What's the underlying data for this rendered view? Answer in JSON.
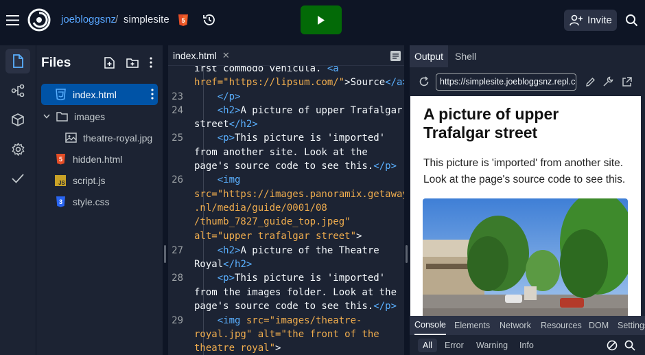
{
  "topbar": {
    "user": "joebloggsnz",
    "separator": "/",
    "repl_name": "simplesite",
    "invite_label": "Invite"
  },
  "sidebar_rail": {
    "items": [
      "files-icon",
      "git-icon",
      "packages-icon",
      "settings-icon",
      "check-icon"
    ]
  },
  "files": {
    "title": "Files",
    "items": [
      {
        "name": "index.html",
        "type": "html",
        "active": true
      },
      {
        "name": "images",
        "type": "folder"
      },
      {
        "name": "theatre-royal.jpg",
        "type": "image"
      },
      {
        "name": "hidden.html",
        "type": "html"
      },
      {
        "name": "script.js",
        "type": "js"
      },
      {
        "name": "style.css",
        "type": "css"
      }
    ]
  },
  "editor": {
    "tab_label": "index.html",
    "line_numbers": [
      "23",
      "24",
      "25",
      "26",
      "27",
      "28",
      "29"
    ]
  },
  "output": {
    "tabs": [
      "Output",
      "Shell"
    ],
    "url": "https://simplesite.joebloggsnz.repl.co",
    "page_heading": "A picture of upper Trafalgar street",
    "page_paragraph": "This picture is 'imported' from another site. Look at the page's source code to see this.",
    "dev_tabs": [
      "Console",
      "Elements",
      "Network",
      "Resources",
      "DOM",
      "Settings"
    ],
    "filters": [
      "All",
      "Error",
      "Warning",
      "Info"
    ]
  },
  "colors": {
    "bg": "#0e1525",
    "panel": "#1c2333",
    "accent": "#0053a6",
    "run": "#036a07",
    "tag": "#5ab0ff",
    "string": "#f0ad4e"
  }
}
